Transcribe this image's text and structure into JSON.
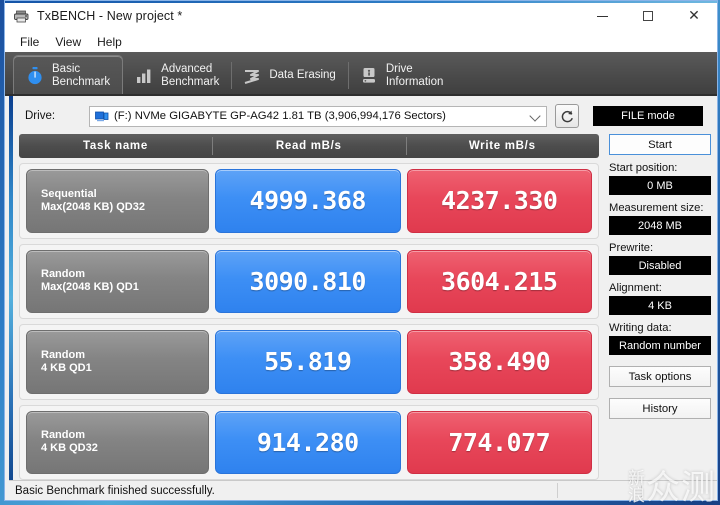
{
  "window": {
    "title": "TxBENCH - New project *",
    "app_icon": "printer-icon",
    "controls": {
      "minimize": "minimize-icon",
      "maximize": "maximize-icon",
      "close": "close-icon"
    }
  },
  "menu": {
    "items": [
      "File",
      "View",
      "Help"
    ]
  },
  "tabs": [
    {
      "id": "basic-benchmark",
      "label": "Basic\nBenchmark",
      "icon": "stopwatch-icon",
      "active": true
    },
    {
      "id": "advanced-benchmark",
      "label": "Advanced\nBenchmark",
      "icon": "bar-chart-icon",
      "active": false
    },
    {
      "id": "data-erasing",
      "label": "Data Erasing",
      "icon": "eraser-icon",
      "active": false
    },
    {
      "id": "drive-information",
      "label": "Drive\nInformation",
      "icon": "drive-info-icon",
      "active": false
    }
  ],
  "drive": {
    "label": "Drive:",
    "selected": "(F:) NVMe GIGABYTE GP-AG42  1.81 TB (3,906,994,176 Sectors)",
    "icon": "hdd-icon",
    "refresh_icon": "refresh-icon",
    "mode_badge": "FILE mode"
  },
  "table": {
    "headers": {
      "task": "Task name",
      "read": "Read mB/s",
      "write": "Write mB/s"
    },
    "rows": [
      {
        "task_line1": "Sequential",
        "task_line2": "Max(2048 KB) QD32",
        "read": "4999.368",
        "write": "4237.330"
      },
      {
        "task_line1": "Random",
        "task_line2": "Max(2048 KB) QD1",
        "read": "3090.810",
        "write": "3604.215"
      },
      {
        "task_line1": "Random",
        "task_line2": "4 KB QD1",
        "read": "55.819",
        "write": "358.490"
      },
      {
        "task_line1": "Random",
        "task_line2": "4 KB QD32",
        "read": "914.280",
        "write": "774.077"
      }
    ]
  },
  "sidebar": {
    "start_button": "Start",
    "fields": [
      {
        "label": "Start position:",
        "value": "0 MB"
      },
      {
        "label": "Measurement size:",
        "value": "2048 MB"
      },
      {
        "label": "Prewrite:",
        "value": "Disabled"
      },
      {
        "label": "Alignment:",
        "value": "4 KB"
      },
      {
        "label": "Writing data:",
        "value": "Random number"
      }
    ],
    "task_options": "Task options",
    "history": "History"
  },
  "statusbar": {
    "message": "Basic Benchmark finished successfully."
  },
  "watermark": {
    "line1": "新",
    "line2": "浪",
    "big": "众测"
  },
  "colors": {
    "read_blue": "#3d8ff5",
    "write_red": "#e8475a",
    "task_gray": "#848484",
    "header_dark": "#4d4d4d",
    "badge_black": "#000000",
    "accent_blue": "#4a90d9"
  }
}
